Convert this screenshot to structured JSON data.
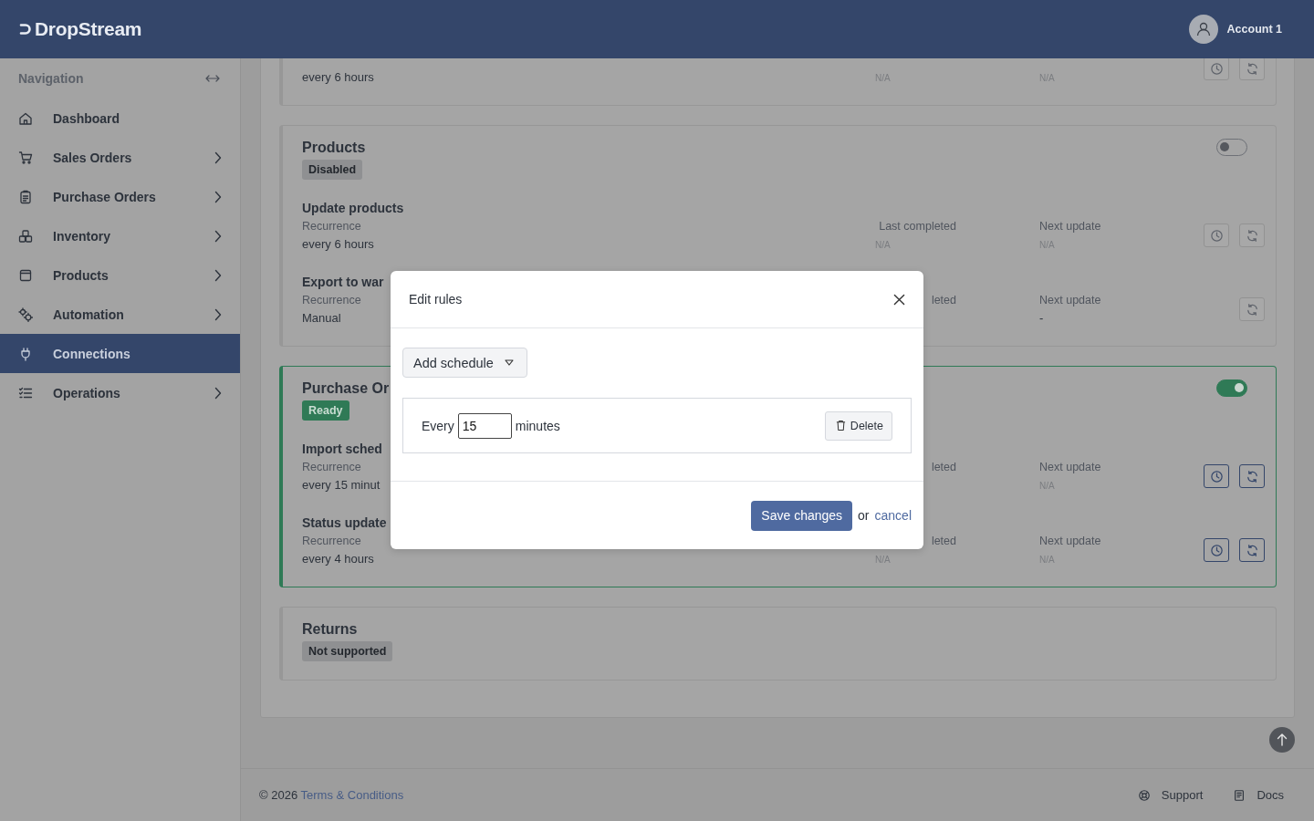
{
  "app": {
    "name": "DropStream",
    "account": "Account 1"
  },
  "sidebar": {
    "title": "Navigation",
    "items": [
      {
        "label": "Dashboard",
        "has_children": false,
        "selected": false
      },
      {
        "label": "Sales Orders",
        "has_children": true,
        "selected": false
      },
      {
        "label": "Purchase Orders",
        "has_children": true,
        "selected": false
      },
      {
        "label": "Inventory",
        "has_children": true,
        "selected": false
      },
      {
        "label": "Products",
        "has_children": true,
        "selected": false
      },
      {
        "label": "Automation",
        "has_children": true,
        "selected": false
      },
      {
        "label": "Connections",
        "has_children": false,
        "selected": true
      },
      {
        "label": "Operations",
        "has_children": true,
        "selected": false
      }
    ]
  },
  "cards": [
    {
      "jobs": [
        {
          "recurrence": "every 6 hours",
          "last_completed": "N/A",
          "next_update": "N/A",
          "has_schedule": true
        }
      ]
    },
    {
      "title": "Products",
      "badge": {
        "label": "Disabled",
        "kind": "neutral"
      },
      "enabled": false,
      "jobs": [
        {
          "name": "Update products",
          "recurrence_label": "Recurrence",
          "recurrence": "every 6 hours",
          "last_completed_label": "Last completed",
          "last_completed": "N/A",
          "next_update_label": "Next update",
          "next_update": "N/A",
          "has_schedule": true
        },
        {
          "name": "Export to war",
          "recurrence_label": "Recurrence",
          "recurrence": "Manual",
          "last_completed_label": "leted",
          "next_update_label": "Next update",
          "next_update": "-",
          "has_schedule": false
        }
      ]
    },
    {
      "title": "Purchase Or",
      "badge": {
        "label": "Ready",
        "kind": "success"
      },
      "enabled": true,
      "jobs": [
        {
          "name": "Import sched",
          "recurrence_label": "Recurrence",
          "recurrence": "every 15 minut",
          "last_completed_label": "leted",
          "next_update_label": "Next update",
          "next_update": "N/A",
          "has_schedule": true
        },
        {
          "name": "Status update",
          "recurrence_label": "Recurrence",
          "recurrence": "every 4 hours",
          "last_completed_label": "leted",
          "last_completed": "N/A",
          "next_update_label": "Next update",
          "next_update": "N/A",
          "has_schedule": true
        }
      ]
    },
    {
      "title": "Returns",
      "badge": {
        "label": "Not supported",
        "kind": "neutral"
      }
    }
  ],
  "modal": {
    "title": "Edit rules",
    "add_button": "Add schedule",
    "rules": [
      {
        "prefix": "Every",
        "value": "15",
        "suffix": "minutes",
        "delete": "Delete"
      }
    ],
    "save": "Save changes",
    "or": "or",
    "cancel": "cancel"
  },
  "footer": {
    "copyright": "© 2026 ",
    "terms": "Terms & Conditions",
    "links": [
      {
        "label": "Support"
      },
      {
        "label": "Docs"
      }
    ]
  }
}
